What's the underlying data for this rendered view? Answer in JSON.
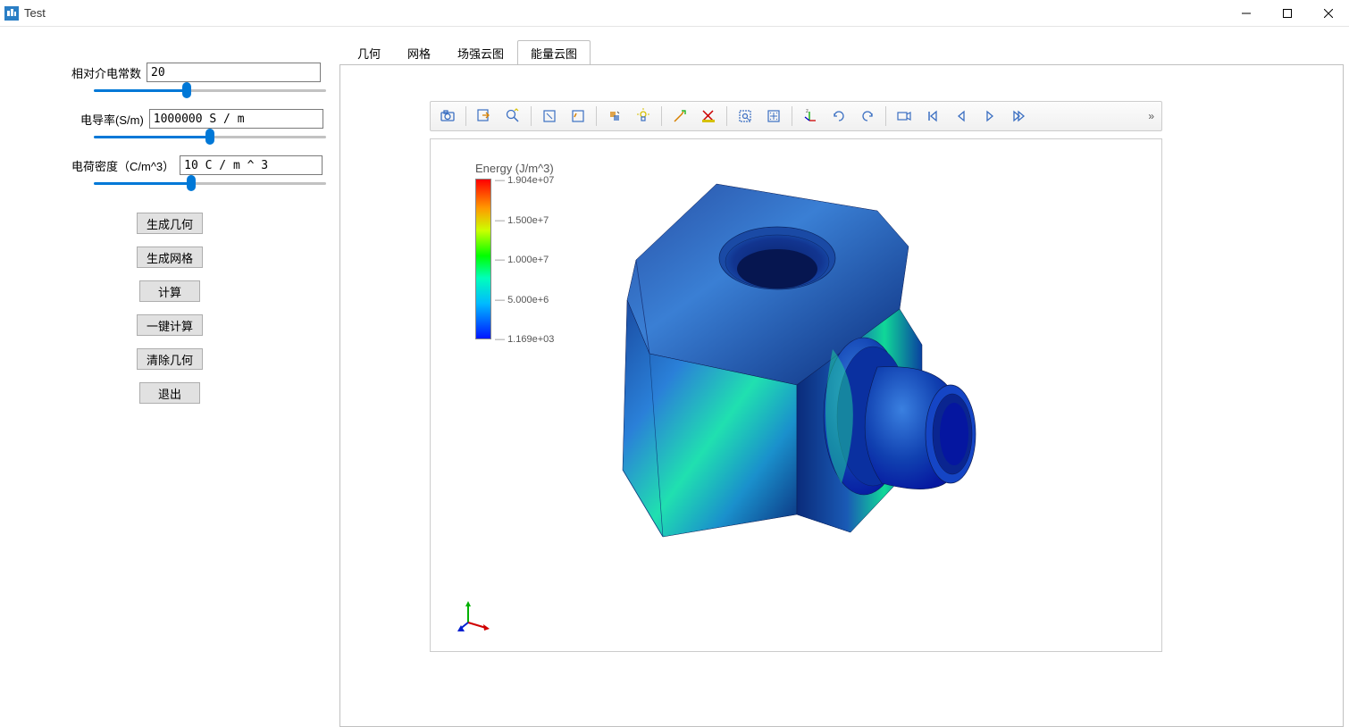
{
  "window": {
    "title": "Test"
  },
  "params": {
    "permittivity_label": "相对介电常数",
    "permittivity_value": "20",
    "conductivity_label": "电导率(S/m)",
    "conductivity_value": "1000000 S / m",
    "charge_label": "电荷密度（C/m^3）",
    "charge_value": "10 C / m ^ 3"
  },
  "buttons": {
    "gen_geom": "生成几何",
    "gen_mesh": "生成网格",
    "calc": "计算",
    "one_click": "一键计算",
    "clear_geom": "清除几何",
    "exit": "退出"
  },
  "tabs": {
    "0": "几何",
    "1": "网格",
    "2": "场强云图",
    "3": "能量云图"
  },
  "toolbar_icons": [
    "camera-icon",
    "export-icon",
    "zoom-icon",
    "box-select-icon",
    "reset-icon",
    "show-hide-icon",
    "light-icon",
    "probe-icon",
    "ruler-icon",
    "roi-icon",
    "fit-icon",
    "triad-icon",
    "rotate-ccw-icon",
    "rotate-cw-icon",
    "view-front-icon",
    "view-first-icon",
    "view-prev-icon",
    "view-next-icon",
    "view-last-icon"
  ],
  "legend": {
    "title": "Energy (J/m^3)",
    "ticks": [
      "1.904e+07",
      "1.500e+7",
      "1.000e+7",
      "5.000e+6",
      "1.169e+03"
    ]
  }
}
